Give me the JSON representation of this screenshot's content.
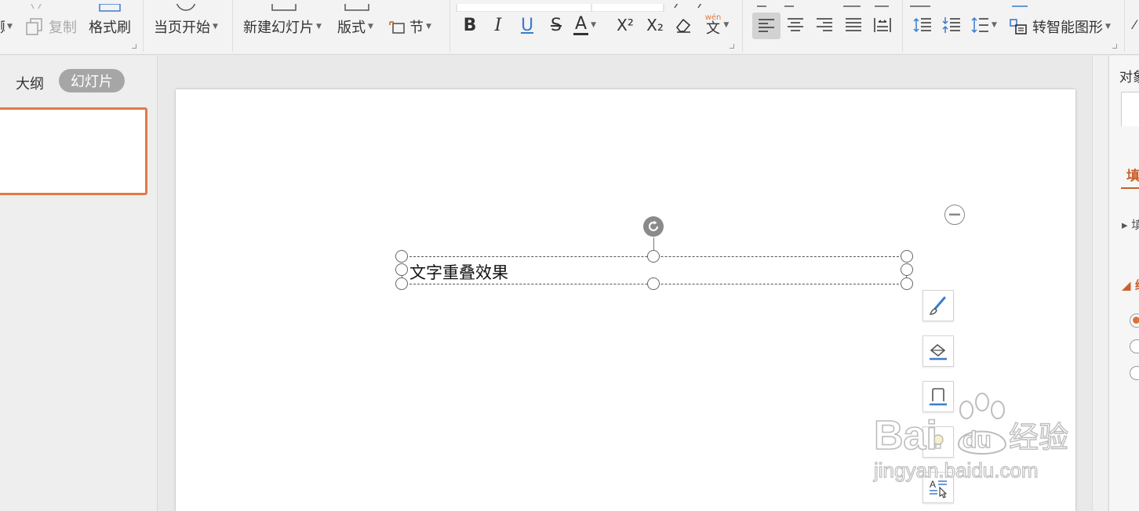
{
  "ribbon": {
    "copy_label": "复制",
    "format_painter_label": "格式刷",
    "from_current_label": "当页开始",
    "new_slide_label": "新建幻灯片",
    "layout_label": "版式",
    "section_label": "节",
    "smart_art_label": "转智能图形",
    "phonetic_glyph": "wén",
    "phonetic_char": "文"
  },
  "left_panel": {
    "tab_outline": "大纲",
    "tab_slides": "幻灯片"
  },
  "slide": {
    "textbox_text": "文字重叠效果"
  },
  "right_panel": {
    "title": "对象属性",
    "fill_tab": "填充",
    "fill_sub": "填充",
    "line_section": "线条",
    "radios": [
      "selected",
      "unselected",
      "unselected"
    ]
  },
  "watermark": {
    "line1_a": "Bai",
    "line1_b": "du",
    "line1_c": "经验",
    "line2": "jingyan.baidu.com"
  },
  "colors": {
    "accent_orange": "#e07b45",
    "underline_blue": "#3b7bd0",
    "ribbon_bg": "#f3f3f3"
  },
  "icons": {
    "bold": "B",
    "italic": "I",
    "underline": "U",
    "strike": "S",
    "font_color": "A",
    "superscript": "X²",
    "subscript": "X₂"
  }
}
